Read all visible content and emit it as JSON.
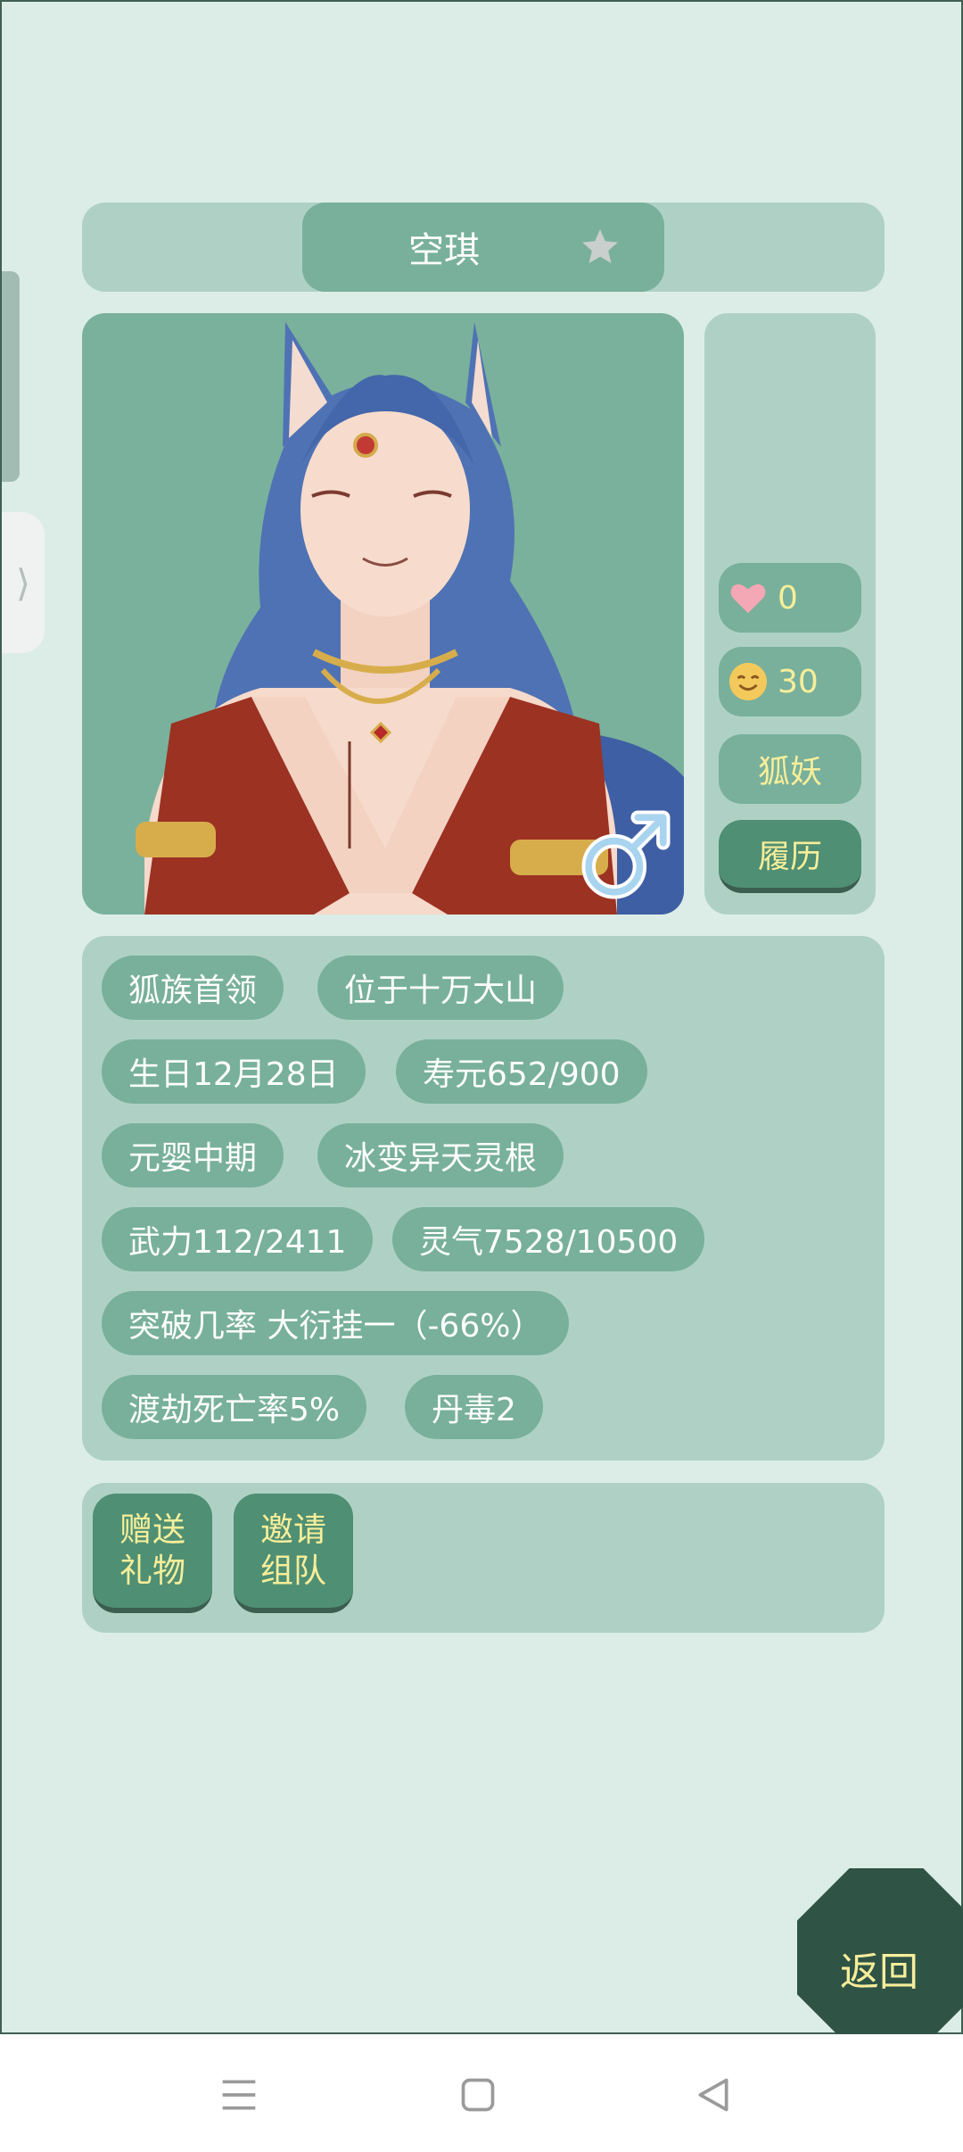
{
  "character": {
    "name": "空琪"
  },
  "side": {
    "favor_value": "0",
    "mood_value": "30",
    "race": "狐妖",
    "resume_label": "履历"
  },
  "tags": [
    "狐族首领",
    "位于十万大山",
    "生日12月28日",
    "寿元652/900",
    "元婴中期",
    "冰变异天灵根",
    "武力112/2411",
    "灵气7528/10500",
    "突破几率 大衍挂一（-66%）",
    "渡劫死亡率5%",
    "丹毒2"
  ],
  "actions": {
    "gift": [
      "赠送",
      "礼物"
    ],
    "invite": [
      "邀请",
      "组队"
    ]
  },
  "return_label": "返回",
  "colors": {
    "background": "#dcede7",
    "panel": "#afd1c5",
    "button": "#78b09b",
    "button_dark": "#4f8f73",
    "accent_text": "#f7ee9a",
    "return": "#2f5345"
  },
  "icons": {
    "title": "star-icon",
    "gender": "male-icon",
    "favor": "heart-icon",
    "mood": "smile-icon",
    "drawer": "chevron-right-icon",
    "nav": [
      "menu-icon",
      "home-square-icon",
      "back-triangle-icon"
    ]
  }
}
